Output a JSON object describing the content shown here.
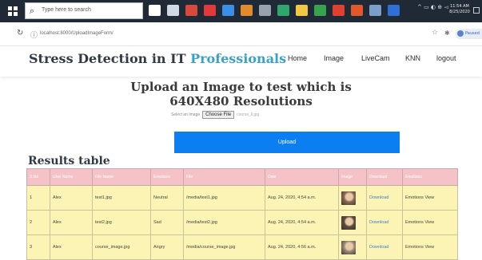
{
  "taskbar": {
    "search_placeholder": "Type here to search",
    "clock_time": "11:54 AM",
    "clock_date": "8/25/2020",
    "app_icons": [
      {
        "name": "cortana-icon",
        "color": "#ffffff"
      },
      {
        "name": "task-view-icon",
        "color": "#cfd8e3"
      },
      {
        "name": "app-icon-1",
        "color": "#d64a3b"
      },
      {
        "name": "app-icon-2",
        "color": "#e23a3a"
      },
      {
        "name": "app-icon-3",
        "color": "#3d8ee6"
      },
      {
        "name": "app-icon-4",
        "color": "#e38a2a"
      },
      {
        "name": "app-icon-5",
        "color": "#9aa3ad"
      },
      {
        "name": "app-icon-6",
        "color": "#2fa76c"
      },
      {
        "name": "app-icon-7",
        "color": "#f2c744"
      },
      {
        "name": "app-icon-8",
        "color": "#37a34a"
      },
      {
        "name": "app-icon-9",
        "color": "#e0412f"
      },
      {
        "name": "app-icon-10",
        "color": "#e0592a"
      },
      {
        "name": "app-icon-11",
        "color": "#7c9fc9"
      },
      {
        "name": "app-icon-12",
        "color": "#2f6fd6"
      }
    ]
  },
  "browser": {
    "url": "localhost:8000/UploadImageForm/",
    "profile_label": "Paused"
  },
  "header": {
    "brand_main": "Stress Detection in IT ",
    "brand_accent": "Professionals",
    "nav": [
      {
        "label": "Home",
        "name": "nav-home"
      },
      {
        "label": "Image",
        "name": "nav-image"
      },
      {
        "label": "LiveCam",
        "name": "nav-livecam"
      },
      {
        "label": "KNN",
        "name": "nav-knn"
      },
      {
        "label": "logout",
        "name": "nav-logout"
      }
    ]
  },
  "upload": {
    "title_line1": "Upload an Image to test which is",
    "title_line2": "640X480 Resolutions",
    "select_label": "Select an Image",
    "choose_file_label": "Choose File",
    "selected_file": "course_ll.jpg",
    "upload_button": "Upload"
  },
  "results": {
    "heading": "Results table",
    "columns": [
      "S.No",
      "User Name",
      "File Name",
      "Emotions",
      "File",
      "Date",
      "Image",
      "Download",
      "Emotions"
    ],
    "rows": [
      {
        "sno": "1",
        "user": "Alex",
        "file_name": "test1.jpg",
        "emotion": "Neutral",
        "file": "/media/test1.jpg",
        "date": "Aug. 24, 2020, 4:54 a.m.",
        "image": "face-thumbnail-1",
        "thumb_color": "#8a6a52",
        "download": "Download",
        "view": "Emotions View"
      },
      {
        "sno": "2",
        "user": "Alex",
        "file_name": "test2.jpg",
        "emotion": "Sad",
        "file": "/media/test2.jpg",
        "date": "Aug. 24, 2020, 4:54 a.m.",
        "image": "face-thumbnail-2",
        "thumb_color": "#5d4a3e",
        "download": "Download",
        "view": "Emotions View"
      },
      {
        "sno": "3",
        "user": "Alex",
        "file_name": "course_image.jpg",
        "emotion": "Angry",
        "file": "/media/course_image.jpg",
        "date": "Aug. 24, 2020, 4:56 a.m.",
        "image": "face-thumbnail-3",
        "thumb_color": "#9c8a7a",
        "download": "Download",
        "view": "Emotions View"
      }
    ]
  }
}
